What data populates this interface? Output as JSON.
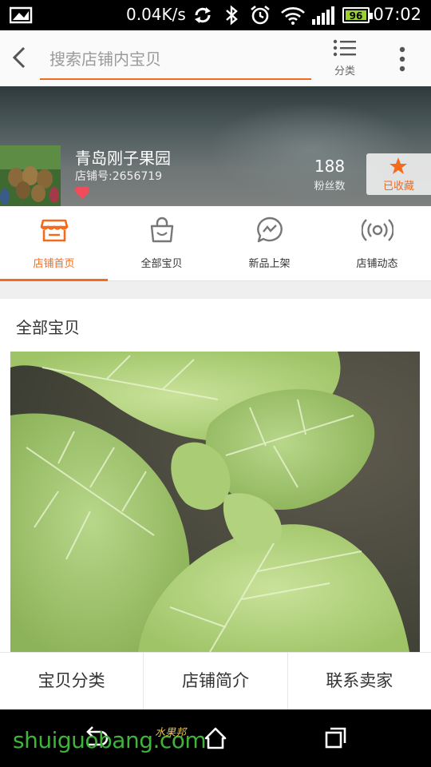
{
  "status_bar": {
    "network_speed": "0.04K/s",
    "battery_level": "96",
    "time": "07:02"
  },
  "search": {
    "placeholder": "搜索店铺内宝贝",
    "category_label": "分类"
  },
  "shop": {
    "name": "青岛刚子果园",
    "shop_id": "店铺号:2656719",
    "fans_count": "188",
    "fans_label": "粉丝数",
    "favorite_label": "已收藏"
  },
  "tabs": [
    {
      "label": "店铺首页",
      "icon": "storefront-icon",
      "active": true
    },
    {
      "label": "全部宝贝",
      "icon": "shopping-bag-icon",
      "active": false
    },
    {
      "label": "新品上架",
      "icon": "new-items-icon",
      "active": false
    },
    {
      "label": "店铺动态",
      "icon": "broadcast-icon",
      "active": false
    }
  ],
  "section": {
    "title": "全部宝贝"
  },
  "bottom_bar": {
    "items": [
      "宝贝分类",
      "店铺简介",
      "联系卖家"
    ]
  },
  "watermark": {
    "text": "shuiguobang.com",
    "sub": "水果邦"
  },
  "colors": {
    "accent": "#f36b1c",
    "status_bar": "#000000",
    "battery_fill": "#9bd12f"
  }
}
